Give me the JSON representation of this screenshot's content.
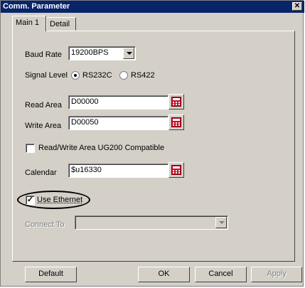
{
  "window": {
    "title": "Comm. Parameter",
    "close_glyph": "✕"
  },
  "tabs": [
    {
      "label": "Main 1",
      "active": true
    },
    {
      "label": "Detail",
      "active": false
    }
  ],
  "baud_rate": {
    "label": "Baud Rate",
    "value": "19200BPS"
  },
  "signal_level": {
    "label": "Signal Level",
    "options": [
      {
        "label": "RS232C",
        "selected": true
      },
      {
        "label": "RS422",
        "selected": false
      }
    ]
  },
  "read_area": {
    "label": "Read Area",
    "value": "D00000",
    "icon": "calculator-icon"
  },
  "write_area": {
    "label": "Write Area",
    "value": "D00050",
    "icon": "calculator-icon"
  },
  "ug200_compat": {
    "label": "Read/Write Area UG200 Compatible",
    "checked": false
  },
  "calendar": {
    "label": "Calendar",
    "value": "$u16330",
    "icon": "calculator-icon"
  },
  "use_ethernet": {
    "label": "Use Ethernet",
    "checked": true,
    "check_glyph": "✓"
  },
  "connect_to": {
    "label": "Connect To",
    "value": "",
    "enabled": false
  },
  "buttons": {
    "default": "Default",
    "ok": "OK",
    "cancel": "Cancel",
    "apply": "Apply"
  },
  "colors": {
    "title_bar": "#0a246a",
    "dialog_face": "#d4d0c8",
    "calculator_red": "#c8102e"
  }
}
